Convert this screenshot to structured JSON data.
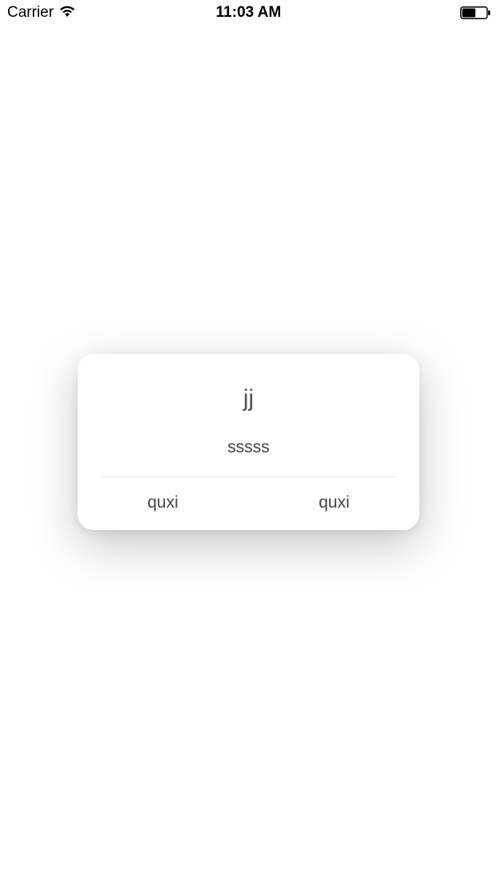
{
  "status_bar": {
    "carrier": "Carrier",
    "time": "11:03 AM",
    "wifi_icon": "wifi-icon",
    "battery_icon": "battery-icon",
    "battery_level": 0.55
  },
  "dialog": {
    "title": "jj",
    "message": "sssss",
    "buttons": [
      {
        "label": "quxi"
      },
      {
        "label": "quxi"
      }
    ]
  },
  "colors": {
    "background": "#ffffff",
    "dialog_background": "#ffffff",
    "text": "#444444",
    "divider": "#e6e6e6"
  }
}
